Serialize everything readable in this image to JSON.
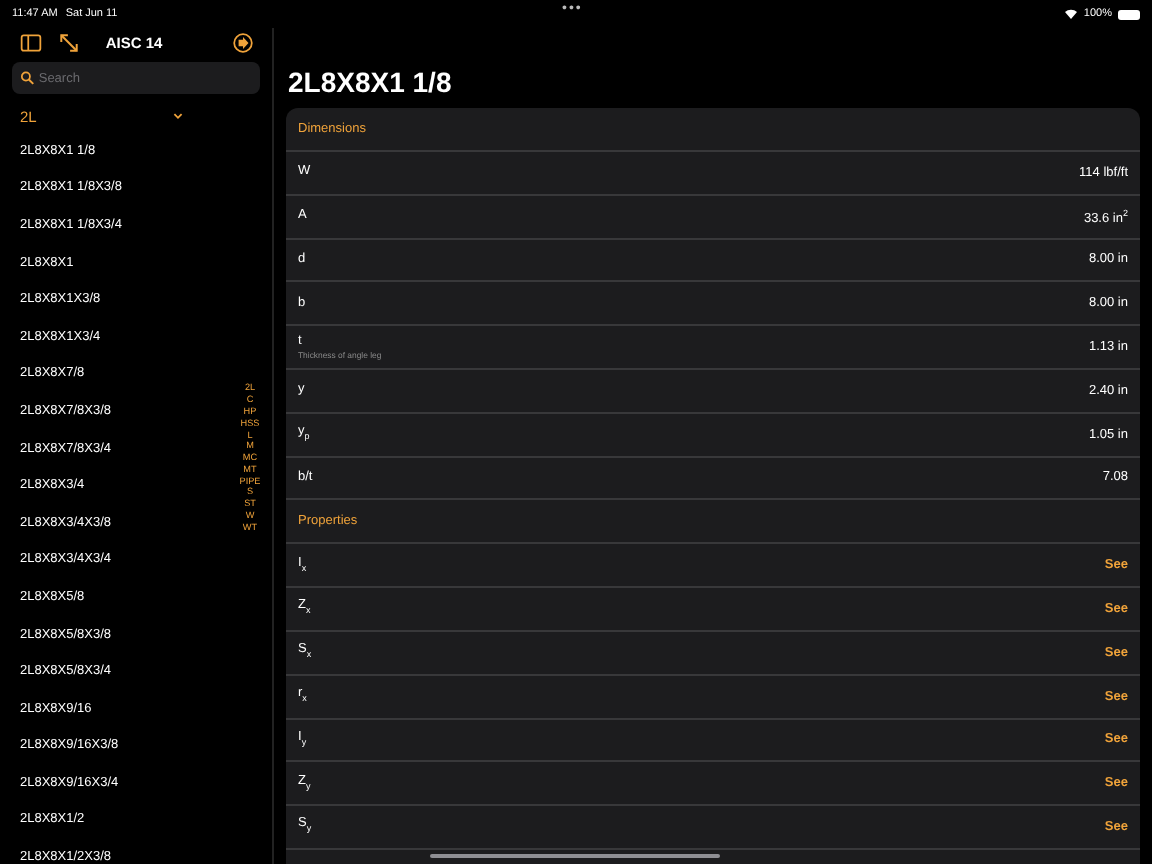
{
  "status_bar": {
    "time": "11:47 AM",
    "date": "Sat Jun 11",
    "dots": "•••",
    "battery": "100%"
  },
  "sidebar": {
    "title": "AISC 14",
    "search": {
      "placeholder": "Search"
    },
    "group": {
      "label": "2L",
      "expanded": true
    },
    "items": [
      "2L8X8X1 1/8",
      "2L8X8X1 1/8X3/8",
      "2L8X8X1 1/8X3/4",
      "2L8X8X1",
      "2L8X8X1X3/8",
      "2L8X8X1X3/4",
      "2L8X8X7/8",
      "2L8X8X7/8X3/8",
      "2L8X8X7/8X3/4",
      "2L8X8X3/4",
      "2L8X8X3/4X3/8",
      "2L8X8X3/4X3/4",
      "2L8X8X5/8",
      "2L8X8X5/8X3/8",
      "2L8X8X5/8X3/4",
      "2L8X8X9/16",
      "2L8X8X9/16X3/8",
      "2L8X8X9/16X3/4",
      "2L8X8X1/2",
      "2L8X8X1/2X3/8"
    ],
    "index": [
      "2L",
      "C",
      "HP",
      "HSS",
      "L",
      "M",
      "MC",
      "MT",
      "PIPE",
      "S",
      "ST",
      "W",
      "WT"
    ]
  },
  "detail": {
    "title": "2L8X8X1 1/8",
    "sections": [
      {
        "header": "Dimensions",
        "rows": [
          {
            "kind": "value",
            "label": "W",
            "value": "114 lbf/ft"
          },
          {
            "kind": "value",
            "label": "A",
            "value": "33.6 in$^{2}$"
          },
          {
            "kind": "value",
            "label": "d",
            "value": "8.00 in"
          },
          {
            "kind": "value",
            "label": "b",
            "value": "8.00 in"
          },
          {
            "kind": "value",
            "label": "t",
            "note": "Thickness of angle leg",
            "value": "1.13 in"
          },
          {
            "kind": "value",
            "label": "y",
            "value": "2.40 in"
          },
          {
            "kind": "value",
            "label": "y$_{p}$",
            "value": "1.05 in"
          },
          {
            "kind": "value",
            "label": "b/t",
            "value": "7.08"
          }
        ]
      },
      {
        "header": "Properties",
        "rows": [
          {
            "kind": "link",
            "label": "I$_{x}$",
            "value": "See"
          },
          {
            "kind": "link",
            "label": "Z$_{x}$",
            "value": "See"
          },
          {
            "kind": "link",
            "label": "S$_{x}$",
            "value": "See"
          },
          {
            "kind": "link",
            "label": "r$_{x}$",
            "value": "See"
          },
          {
            "kind": "link",
            "label": "I$_{y}$",
            "value": "See"
          },
          {
            "kind": "link",
            "label": "Z$_{y}$",
            "value": "See"
          },
          {
            "kind": "link",
            "label": "S$_{y}$",
            "value": "See"
          }
        ]
      }
    ]
  }
}
